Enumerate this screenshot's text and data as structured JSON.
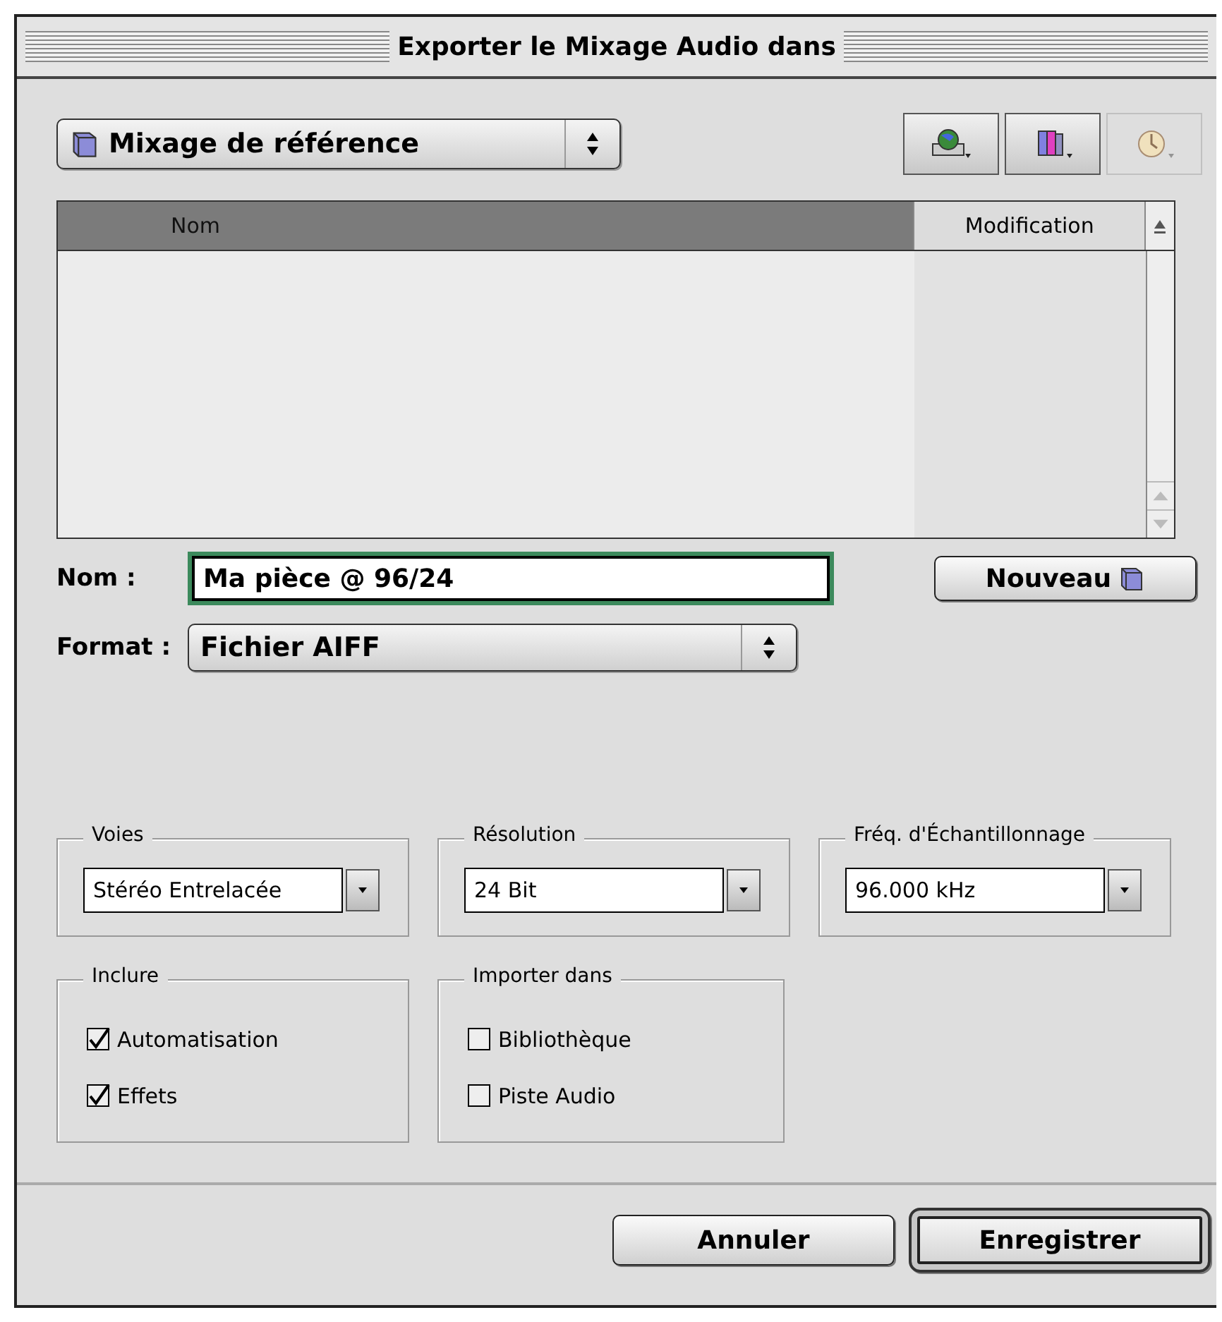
{
  "window": {
    "title": "Exporter le Mixage Audio dans"
  },
  "location_popup": {
    "value": "Mixage de référence"
  },
  "toolbar": [
    {
      "kind": "globe",
      "disabled": false
    },
    {
      "kind": "books",
      "disabled": false
    },
    {
      "kind": "clock",
      "disabled": true
    }
  ],
  "file_list": {
    "columns": [
      {
        "label": "Nom",
        "selected": true
      },
      {
        "label": "Modification",
        "selected": false
      }
    ]
  },
  "name_field": {
    "label": "Nom :",
    "value": "Ma pièce @ 96/24"
  },
  "new_button": {
    "label": "Nouveau"
  },
  "format": {
    "label": "Format :",
    "value": "Fichier AIFF"
  },
  "option_groups": [
    {
      "title": "Voies",
      "value": "Stéréo Entrelacée"
    },
    {
      "title": "Résolution",
      "value": "24 Bit"
    },
    {
      "title": "Fréq. d'Échantillonnage",
      "value": "96.000 kHz"
    }
  ],
  "checkbox_groups": [
    {
      "title": "Inclure",
      "items": [
        {
          "label": "Automatisation",
          "checked": true
        },
        {
          "label": "Effets",
          "checked": true
        }
      ]
    },
    {
      "title": "Importer dans",
      "items": [
        {
          "label": "Bibliothèque",
          "checked": false
        },
        {
          "label": "Piste Audio",
          "checked": false
        }
      ]
    }
  ],
  "buttons": [
    {
      "label": "Annuler",
      "default": false
    },
    {
      "label": "Enregistrer",
      "default": true
    }
  ]
}
